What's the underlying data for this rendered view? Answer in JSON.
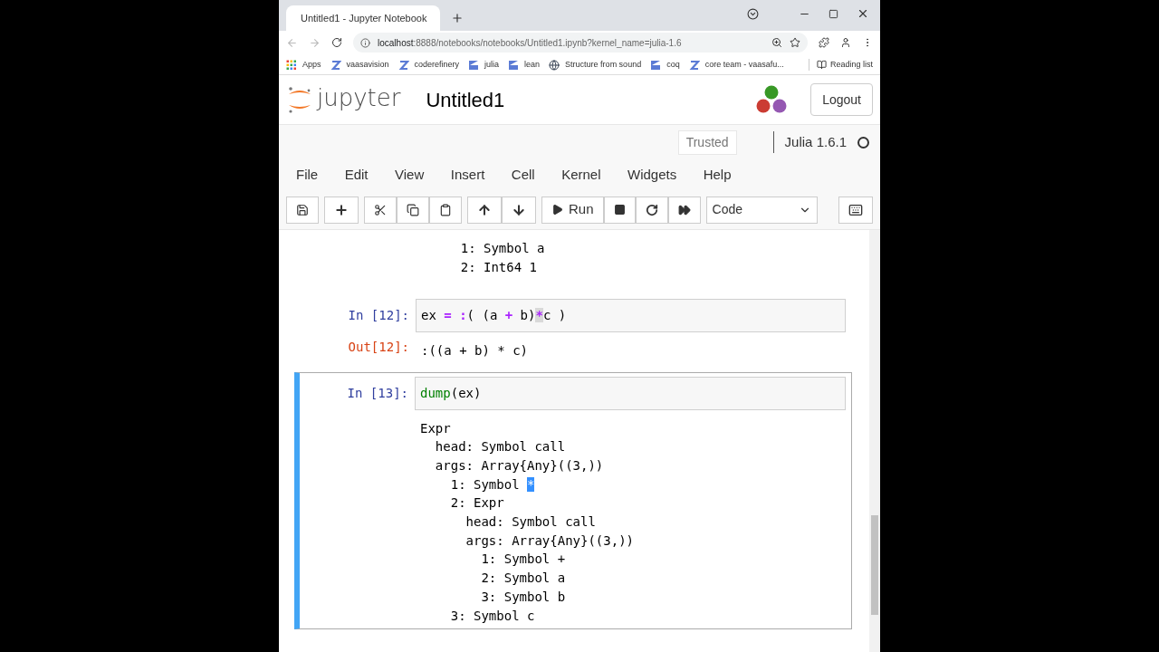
{
  "browser": {
    "tab_title": "Untitled1 - Jupyter Notebook",
    "url_host": "localhost",
    "url_rest": ":8888/notebooks/notebooks/Untitled1.ipynb?kernel_name=julia-1.6",
    "bookmarks": [
      {
        "label": "Apps",
        "kind": "apps"
      },
      {
        "label": "vaasavision",
        "kind": "z"
      },
      {
        "label": "coderefinery",
        "kind": "z"
      },
      {
        "label": "julia",
        "kind": "badge"
      },
      {
        "label": "lean",
        "kind": "badge"
      },
      {
        "label": "Structure from sound",
        "kind": "globe"
      },
      {
        "label": "coq",
        "kind": "badge"
      },
      {
        "label": "core team - vaasafu...",
        "kind": "z"
      }
    ],
    "reading_list": "Reading list"
  },
  "header": {
    "logo_text": "jupyter",
    "notebook_name": "Untitled1",
    "logout": "Logout",
    "trusted": "Trusted",
    "kernel": "Julia 1.6.1"
  },
  "menu": [
    "File",
    "Edit",
    "View",
    "Insert",
    "Cell",
    "Kernel",
    "Widgets",
    "Help"
  ],
  "toolbar": {
    "run": "Run",
    "cell_type": "Code"
  },
  "cut_output": {
    "lines": [
      "    1: Symbol a",
      "    2: Int64 1"
    ]
  },
  "cells": [
    {
      "selected": false,
      "prompt": "In [12]:",
      "code": [
        {
          "text": "ex ",
          "kind": "plain"
        },
        {
          "text": "= :",
          "kind": "operator"
        },
        {
          "text": "( (a ",
          "kind": "plain"
        },
        {
          "text": "+",
          "kind": "operator"
        },
        {
          "text": " b)",
          "kind": "plain"
        },
        {
          "text": "*",
          "kind": "cursor"
        },
        {
          "text": "c )",
          "kind": "plain"
        }
      ],
      "out_prompt": "Out[12]:",
      "output": [
        [
          {
            "text": ":((a + b) * c)",
            "selected": false
          }
        ]
      ]
    },
    {
      "selected": true,
      "prompt": "In [13]:",
      "code": [
        {
          "text": "dump",
          "kind": "builtin"
        },
        {
          "text": "(ex)",
          "kind": "plain"
        }
      ],
      "output": [
        [
          {
            "text": "Expr",
            "selected": false
          }
        ],
        [
          {
            "text": "  head: Symbol call",
            "selected": false
          }
        ],
        [
          {
            "text": "  args: Array{Any}((3,))",
            "selected": false
          }
        ],
        [
          {
            "text": "    1: Symbol ",
            "selected": false
          },
          {
            "text": "*",
            "selected": true
          }
        ],
        [
          {
            "text": "    2: Expr",
            "selected": false
          }
        ],
        [
          {
            "text": "      head: Symbol call",
            "selected": false
          }
        ],
        [
          {
            "text": "      args: Array{Any}((3,))",
            "selected": false
          }
        ],
        [
          {
            "text": "        1: Symbol +",
            "selected": false
          }
        ],
        [
          {
            "text": "        2: Symbol a",
            "selected": false
          }
        ],
        [
          {
            "text": "        3: Symbol b",
            "selected": false
          }
        ],
        [
          {
            "text": "    3: Symbol c",
            "selected": false
          }
        ]
      ]
    }
  ]
}
